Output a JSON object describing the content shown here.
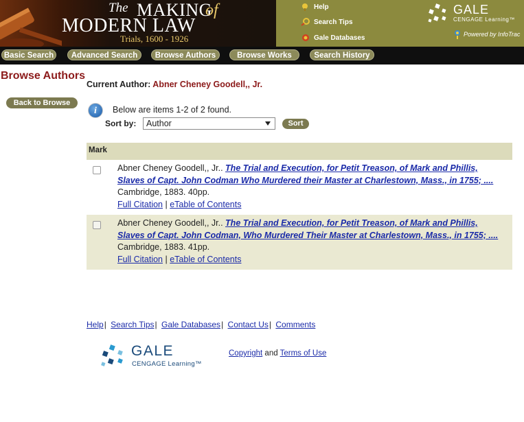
{
  "header": {
    "title_the": "The",
    "title_making": "MAKING",
    "title_of": "of",
    "title_modern": "MODERN LAW",
    "title_years": "Trials, 1600 - 1926",
    "links": [
      {
        "label": "Help",
        "icon": "help-icon"
      },
      {
        "label": "Search Tips",
        "icon": "search-tips-icon"
      },
      {
        "label": "Gale Databases",
        "icon": "gale-databases-icon"
      }
    ],
    "brand": {
      "name": "GALE",
      "sub": "CENGAGE Learning™",
      "powered": "Powered by InfoTrac"
    }
  },
  "nav": {
    "items": [
      {
        "label": "Basic Search"
      },
      {
        "label": "Advanced Search"
      },
      {
        "label": "Browse Authors"
      },
      {
        "label": "Browse Works"
      },
      {
        "label": "Search History"
      }
    ]
  },
  "sidebar": {
    "title": "Browse Authors",
    "back_label": "Back to Browse"
  },
  "main": {
    "current_author_label": "Current Author:",
    "current_author_name": "Abner Cheney Goodell,, Jr.",
    "found_text": "Below are items 1-2 of 2 found.",
    "sort_label": "Sort by:",
    "sort_value": "Author",
    "sort_button": "Sort",
    "mark_header": "Mark",
    "results": [
      {
        "author": "Abner Cheney Goodell,, Jr..",
        "title": "The Trial and Execution, for Petit Treason, of Mark and Phillis, Slaves of Capt. John Codman Who Murdered their Master at Charlestown, Mass., in 1755; ....",
        "imprint": "Cambridge, 1883. 40pp.",
        "full_citation": "Full Citation",
        "etoc": "eTable of Contents",
        "sep": "|"
      },
      {
        "author": "Abner Cheney Goodell,, Jr..",
        "title": "The Trial and Execution, for Petit Treason, of Mark and Phillis, Slaves of Capt. John Codman, Who Murdered Their Master at Charlestown, Mass., in 1755; ....",
        "imprint": "Cambridge, 1883. 41pp.",
        "full_citation": "Full Citation",
        "etoc": "eTable of Contents",
        "sep": "|"
      }
    ]
  },
  "footer": {
    "links": [
      "Help",
      "Search Tips",
      "Gale Databases",
      "Contact Us",
      "Comments"
    ],
    "sep": "|",
    "brand": {
      "name": "GALE",
      "sub": "CENGAGE Learning™"
    },
    "copyright": "Copyright",
    "and": "and",
    "terms": "Terms of Use"
  }
}
